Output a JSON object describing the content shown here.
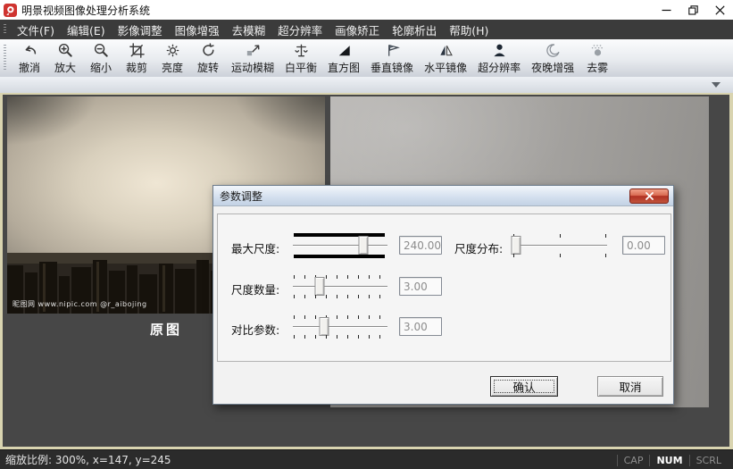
{
  "titlebar": {
    "title": "明景视频图像处理分析系统"
  },
  "menubar": {
    "items": [
      {
        "label": "文件(F)"
      },
      {
        "label": "编辑(E)"
      },
      {
        "label": "影像调整"
      },
      {
        "label": "图像增强"
      },
      {
        "label": "去模糊"
      },
      {
        "label": "超分辨率"
      },
      {
        "label": "画像矫正"
      },
      {
        "label": "轮廓析出"
      },
      {
        "label": "帮助(H)"
      }
    ]
  },
  "toolbar": {
    "buttons": [
      {
        "icon": "undo-icon",
        "label": "撤消"
      },
      {
        "icon": "zoom-in-icon",
        "label": "放大"
      },
      {
        "icon": "zoom-out-icon",
        "label": "缩小"
      },
      {
        "icon": "crop-icon",
        "label": "裁剪"
      },
      {
        "icon": "brightness-icon",
        "label": "亮度"
      },
      {
        "icon": "rotate-icon",
        "label": "旋转"
      },
      {
        "icon": "motion-blur-icon",
        "label": "运动模糊"
      },
      {
        "icon": "white-balance-icon",
        "label": "白平衡"
      },
      {
        "icon": "histogram-icon",
        "label": "直方图"
      },
      {
        "icon": "vertical-mirror-icon",
        "label": "垂直镜像"
      },
      {
        "icon": "horizontal-mirror-icon",
        "label": "水平镜像"
      },
      {
        "icon": "super-resolution-icon",
        "label": "超分辨率"
      },
      {
        "icon": "night-enhance-icon",
        "label": "夜晚增强"
      },
      {
        "icon": "dehaze-icon",
        "label": "去雾"
      }
    ]
  },
  "viewer": {
    "original_caption": "原图",
    "watermark": "昵图网 www.nipic.com   @r_aibojing"
  },
  "dialog": {
    "title": "参数调整",
    "close_glyph": "x",
    "fields": {
      "max_scale": {
        "label": "最大尺度:",
        "value": "240.00",
        "percent": 74
      },
      "scale_dist": {
        "label": "尺度分布:",
        "value": "0.00",
        "percent": 5
      },
      "scale_count": {
        "label": "尺度数量:",
        "value": "3.00",
        "percent": 29
      },
      "contrast": {
        "label": "对比参数:",
        "value": "3.00",
        "percent": 34
      }
    },
    "ok_label": "确认",
    "cancel_label": "取消"
  },
  "status": {
    "zoom_info": "缩放比例: 300%,   x=147, y=245",
    "cap": "CAP",
    "num": "NUM",
    "scrl": "SCRL"
  },
  "colors": {
    "close_button_red": "#b03022",
    "panel_border_cream": "#d9d4b0",
    "canvas_bg": "#474747",
    "menubar_bg": "#3b3b3b",
    "statusbar_bg": "#2b2b2b"
  }
}
